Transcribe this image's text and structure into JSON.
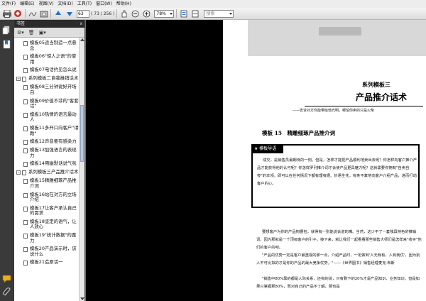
{
  "menu": [
    "文件(F)",
    "编辑(E)",
    "视图(V)",
    "文档(D)",
    "工具(T)",
    "窗口(W)",
    "帮助(H)"
  ],
  "toolbar": {
    "page_number": "63",
    "page_count": "( 73 / 256 )",
    "zoom": "78%",
    "search_placeholder": "搜索"
  },
  "bookmarks": {
    "title": "书签",
    "close": "x",
    "items": [
      {
        "level": "child",
        "label": "模板05适当制造一点悬念"
      },
      {
        "level": "child",
        "label": "模板06\"惊人之语\"的使用"
      },
      {
        "level": "child",
        "label": "模板07电话约见怎么说"
      },
      {
        "level": "parent",
        "label": "系列模板二自我推销话术"
      },
      {
        "level": "child",
        "label": "模板08三分钟说好开场白"
      },
      {
        "level": "child",
        "label": "模板09价值不菲的\"客套话\""
      },
      {
        "level": "child",
        "label": "模板10热情的语言最动人"
      },
      {
        "level": "child",
        "label": "模板11多开口向客户\"请教\""
      },
      {
        "level": "child",
        "label": "模板12声音要有感染力"
      },
      {
        "level": "child",
        "label": "模板13加强语言的表现力"
      },
      {
        "level": "child",
        "label": "模板14用幽默话说气氛"
      },
      {
        "level": "parent",
        "label": "系列模板三产品推介话术"
      },
      {
        "level": "child",
        "label": "模板15精雕细琢产品推介词"
      },
      {
        "level": "child",
        "label": "模板16站在对方的立场介绍"
      },
      {
        "level": "child",
        "label": "模板17让客户承认自己的需求"
      },
      {
        "level": "child",
        "label": "模板18坚定的语气，让人放心"
      },
      {
        "level": "child",
        "label": "模板19\"统计数据\"的魔力"
      },
      {
        "level": "child",
        "label": "模板20产品演示时，该说什么"
      },
      {
        "level": "child",
        "label": "模板21造原话一"
      }
    ]
  },
  "page": {
    "series_title": "系列模板三",
    "topic_title": "产品推介话术",
    "quote": "——告诉对方你能带给他光明，哪怕你卖的只是火柴",
    "template_title": "模板 15　精雕细琢产品推介词",
    "box_tag": "★ 模板导语",
    "box_text": "成交，是销售员最期待的一刻。但是，怎样才能把产品顺利地卖出去呢？你怎样向客户推介产品才能获得他的认可呢？你怎样罗列推介词才会使产品更具魅力呢？这就需要你拥有\"自卖自夸\"的本领。即可以在任何情况下都有理有据、妙语生花，有条不紊地向客户介绍产品，进而打动客户的心。",
    "para1": "要想客户为你的产品掏腰包，就得有一张能说会道的嘴。当然，这少不了一套独具特色的推销词，因为那就是一个顶级客户的引子。接下来，就让我们一起看看那些销售大师们是怎样来\"收买\"他们的客户的吧。",
    "para2": "\"产品的优势一定是客户最重视的那一点，介绍产品时，一定做到'人无我有，人有我优'，因为别人不可比拟的才是你的产品的最大竞争优势。\"——《世界图书》销售经理麦克·希斯",
    "para3": "\"销售中80%靠的都是人际关系，还有的说，只有剩下的20%才是产品知识、业务知识，但是如果只掌握那80%，而对自己的产品不了解，那也是"
  },
  "colors": {
    "rail": "#3a3a3a",
    "panel_header": "#2b2b2b",
    "doc_bg": "#6e6e6e"
  }
}
